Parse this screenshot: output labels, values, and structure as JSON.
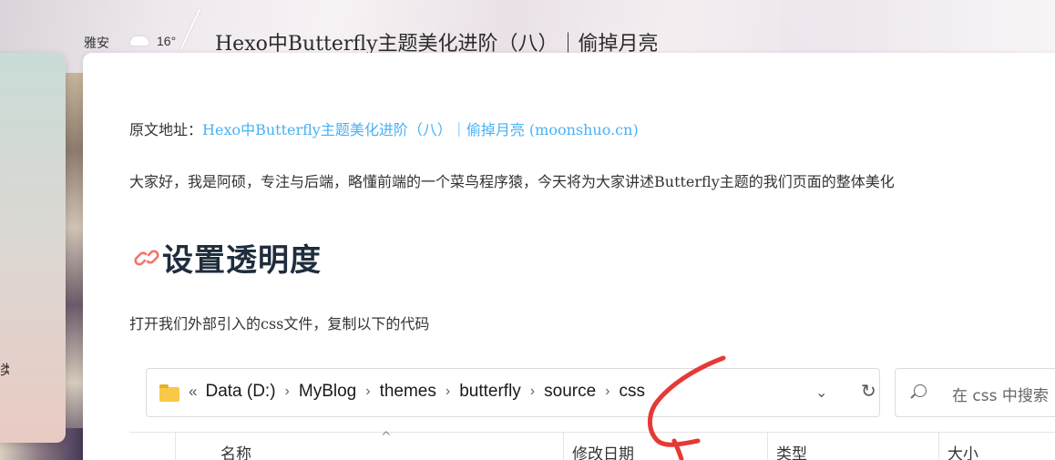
{
  "weather": {
    "city": "雅安",
    "temperature": "16°"
  },
  "page": {
    "title": "Hexo中Butterfly主题美化进阶（八）｜偷掉月亮"
  },
  "sidebar": {
    "partial_text": "类"
  },
  "article": {
    "source_label": "原文地址：",
    "source_link_text": "Hexo中Butterfly主题美化进阶（八）｜偷掉月亮 (moonshuo.cn)",
    "intro": "大家好，我是阿硕，专注与后端，略懂前端的一个菜鸟程序猿，今天将为大家讲述Butterfly主题的我们页面的整体美化",
    "heading": "设置透明度",
    "paragraph": "打开我们外部引入的css文件，复制以下的代码"
  },
  "explorer": {
    "path_start": "«",
    "breadcrumbs": [
      "Data (D:)",
      "MyBlog",
      "themes",
      "butterfly",
      "source",
      "css"
    ],
    "search_placeholder": "在 css 中搜索",
    "columns": [
      "名称",
      "修改日期",
      "类型",
      "大小"
    ]
  },
  "colors": {
    "link": "#49b1f5",
    "heading": "#1f2d3d",
    "link_icon": "#f47466",
    "annotation": "#e53935"
  }
}
